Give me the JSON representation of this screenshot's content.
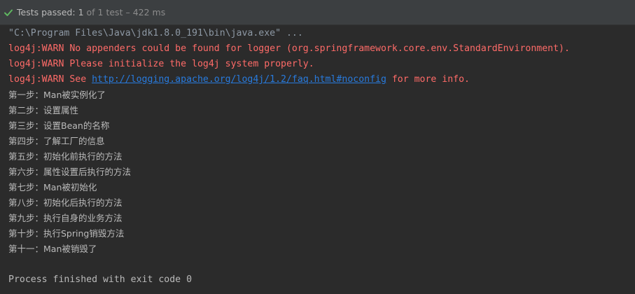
{
  "status": {
    "text": "Tests passed:",
    "count": "1",
    "total": "of 1 test",
    "duration": "– 422 ms"
  },
  "console": {
    "command": "\"C:\\Program Files\\Java\\jdk1.8.0_191\\bin\\java.exe\" ...",
    "warn1": "log4j:WARN No appenders could be found for logger (org.springframework.core.env.StandardEnvironment).",
    "warn2": "log4j:WARN Please initialize the log4j system properly.",
    "warn3_prefix": "log4j:WARN See ",
    "warn3_link": "http://logging.apache.org/log4j/1.2/faq.html#noconfig",
    "warn3_suffix": " for more info.",
    "output_lines": [
      "第一步：Man被实例化了",
      "第二步：设置属性",
      "第三步：设置Bean的名称",
      "第四步：了解工厂的信息",
      "第五步：初始化前执行的方法",
      "第六步：属性设置后执行的方法",
      "第七步：Man被初始化",
      "第八步：初始化后执行的方法",
      "第九步：执行自身的业务方法",
      "第十步：执行Spring销毁方法",
      "第十一：Man被销毁了"
    ],
    "exit_message": "Process finished with exit code 0"
  },
  "colors": {
    "background": "#2b2b2b",
    "status_bar": "#3c3f41",
    "warn": "#ff6b68",
    "link": "#287bde",
    "pass_check": "#5fb760"
  },
  "icons": {
    "status": "check-icon"
  }
}
